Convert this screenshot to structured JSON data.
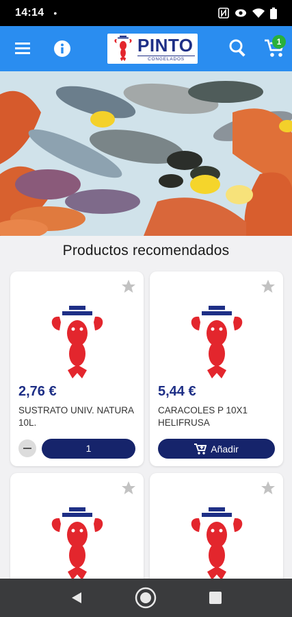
{
  "status_bar": {
    "time": "14:14",
    "dot": "•"
  },
  "app_bar": {
    "logo_text": "PINTO",
    "logo_sub": "CONGELADOS",
    "cart_count": "1",
    "colors": {
      "bar": "#2a8df0",
      "badge": "#29b03a"
    }
  },
  "section": {
    "title": "Productos recomendados"
  },
  "products": [
    {
      "price": "2,76 €",
      "name": "SUSTRATO UNIV. NATURA 10L.",
      "quantity": "1",
      "in_cart": true
    },
    {
      "price": "5,44 €",
      "name": "CARACOLES P 10x1 HELIFRUSA",
      "button_label": "Añadir",
      "in_cart": false
    },
    {
      "price": "",
      "name": ""
    },
    {
      "price": "",
      "name": ""
    }
  ],
  "colors": {
    "brand_navy": "#16246b",
    "price": "#1e2f86",
    "lobster_red": "#e3262d"
  },
  "icons": [
    "menu-icon",
    "info-icon",
    "search-icon",
    "cart-icon",
    "star-icon",
    "cart-plus-icon",
    "back-icon",
    "home-icon",
    "recent-apps-icon"
  ]
}
